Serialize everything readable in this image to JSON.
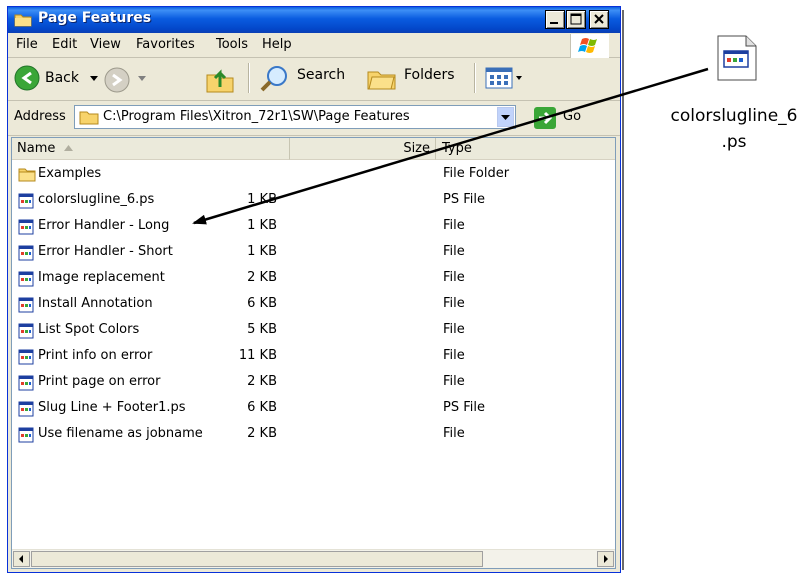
{
  "window": {
    "title": "Page Features",
    "menu": [
      "File",
      "Edit",
      "View",
      "Favorites",
      "Tools",
      "Help"
    ],
    "toolbar": {
      "back": "Back",
      "search": "Search",
      "folders": "Folders"
    },
    "address": {
      "label": "Address",
      "value": "C:\\Program Files\\Xitron_72r1\\SW\\Page Features",
      "go": "Go"
    },
    "columns": {
      "name": "Name",
      "size": "Size",
      "type": "Type"
    },
    "files": [
      {
        "name": "Examples",
        "size": "",
        "type": "File Folder",
        "icon": "folder-icon"
      },
      {
        "name": "colorslugline_6.ps",
        "size": "1 KB",
        "type": "PS File",
        "icon": "file-icon"
      },
      {
        "name": "Error Handler - Long",
        "size": "1 KB",
        "type": "File",
        "icon": "file-icon"
      },
      {
        "name": "Error Handler - Short",
        "size": "1 KB",
        "type": "File",
        "icon": "file-icon"
      },
      {
        "name": "Image replacement",
        "size": "2 KB",
        "type": "File",
        "icon": "file-icon"
      },
      {
        "name": "Install Annotation",
        "size": "6 KB",
        "type": "File",
        "icon": "file-icon"
      },
      {
        "name": "List Spot Colors",
        "size": "5 KB",
        "type": "File",
        "icon": "file-icon"
      },
      {
        "name": "Print info on error",
        "size": "11 KB",
        "type": "File",
        "icon": "file-icon"
      },
      {
        "name": "Print page on error",
        "size": "2 KB",
        "type": "File",
        "icon": "file-icon"
      },
      {
        "name": "Slug Line + Footer1.ps",
        "size": "6 KB",
        "type": "PS File",
        "icon": "file-icon"
      },
      {
        "name": "Use filename as jobname",
        "size": "2 KB",
        "type": "File",
        "icon": "file-icon"
      }
    ]
  },
  "desktop_file": {
    "label_line1": "colorslugline_6",
    "label_line2": ".ps",
    "icon": "ps-file-icon"
  },
  "colors": {
    "title_bar": "#0a5ce0",
    "window_bg": "#ece9d8",
    "arrow": "#000000"
  }
}
